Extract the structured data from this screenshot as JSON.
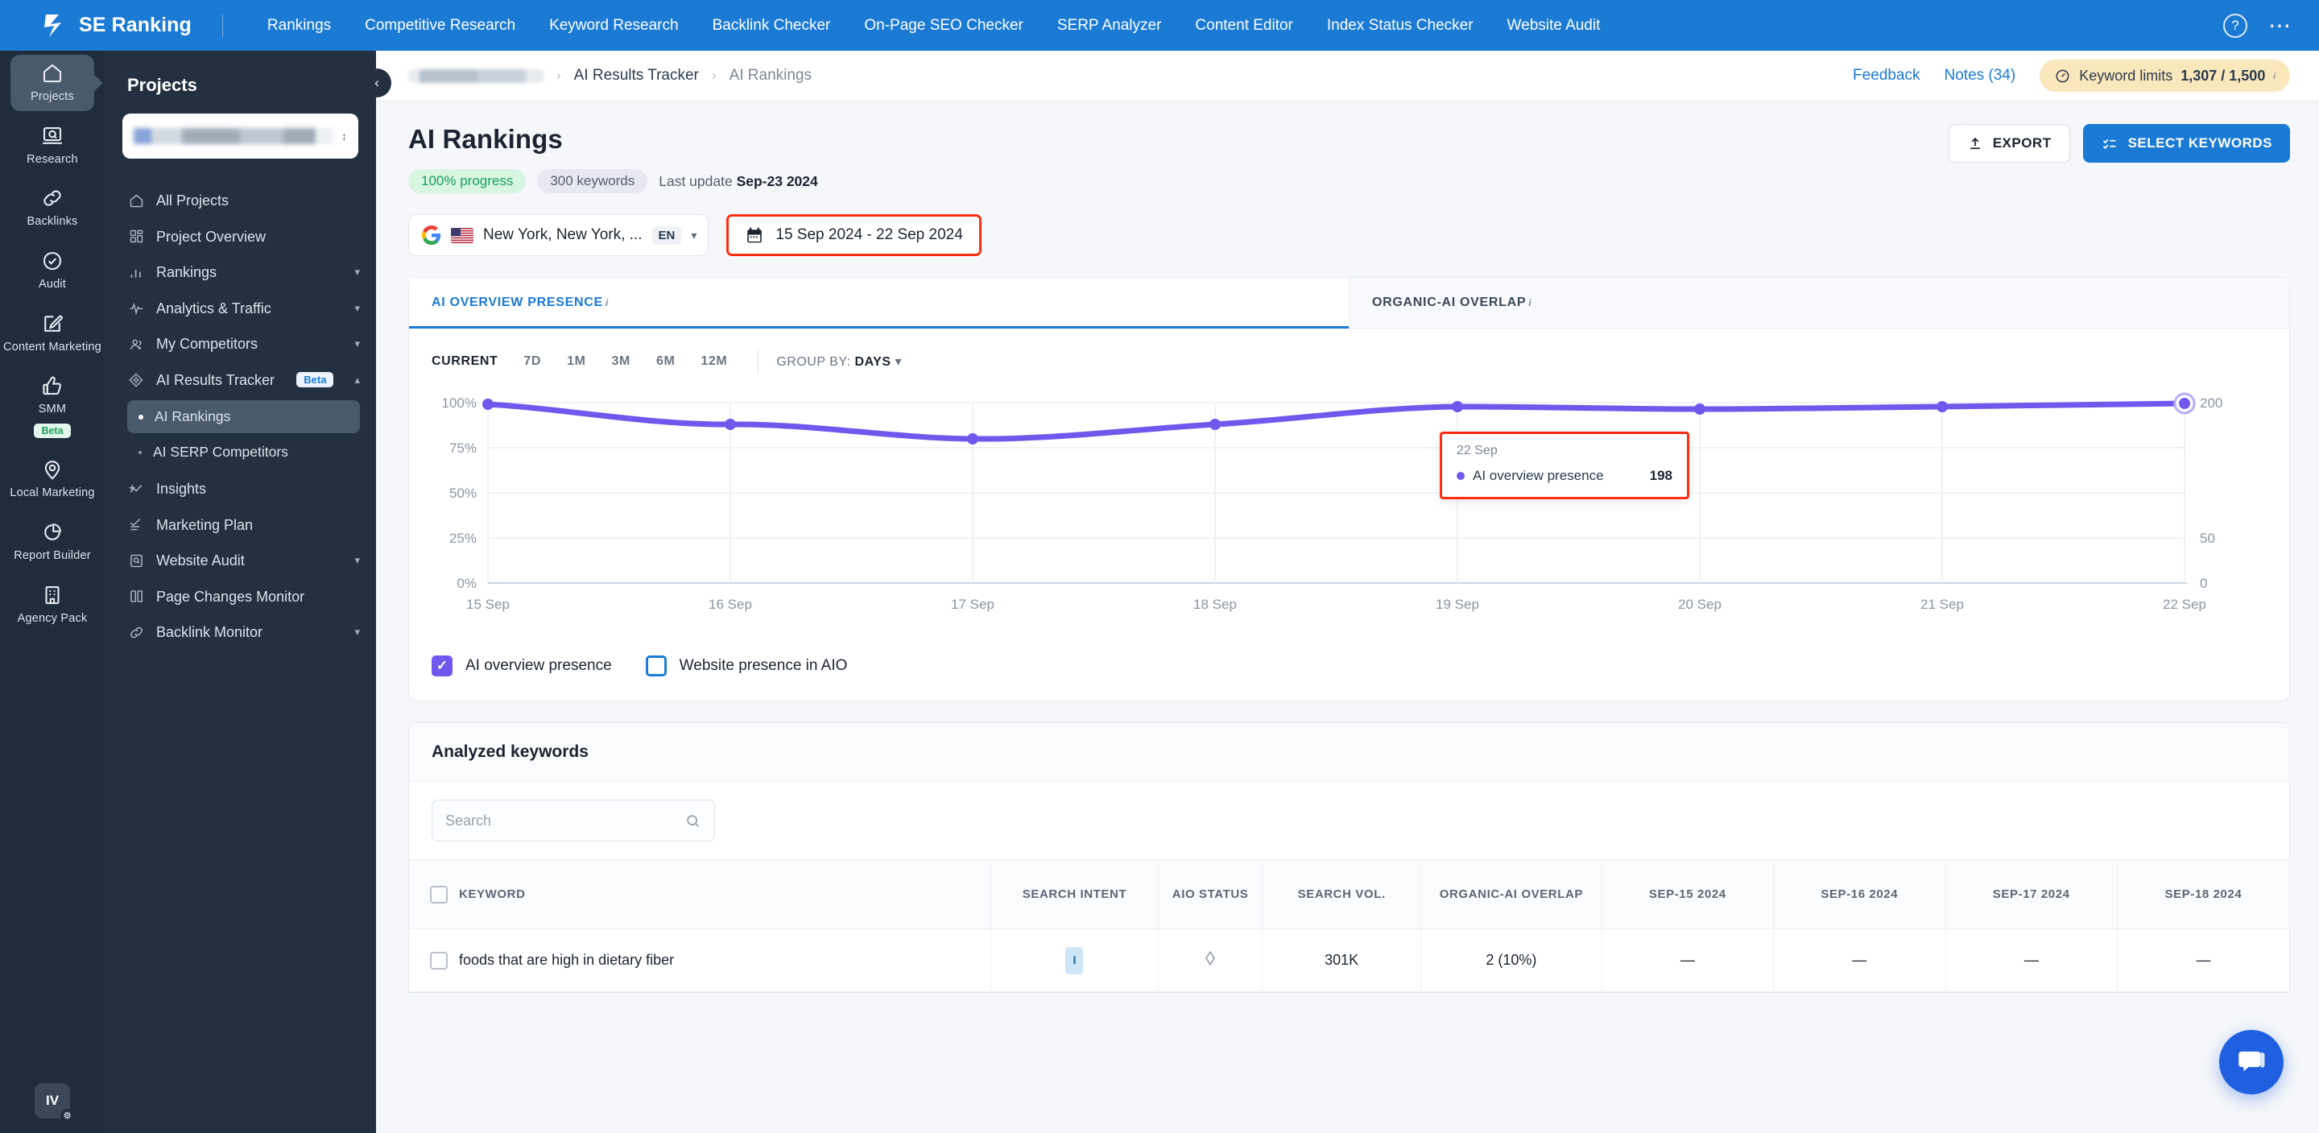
{
  "topbar": {
    "brand": "SE Ranking",
    "nav": [
      "Rankings",
      "Competitive Research",
      "Keyword Research",
      "Backlink Checker",
      "On-Page SEO Checker",
      "SERP Analyzer",
      "Content Editor",
      "Index Status Checker",
      "Website Audit"
    ],
    "help_label": "?",
    "more_label": "⋯"
  },
  "rail": {
    "items": [
      {
        "label": "Projects",
        "icon": "home-icon",
        "active": true,
        "beta": ""
      },
      {
        "label": "Research",
        "icon": "research-icon",
        "active": false,
        "beta": ""
      },
      {
        "label": "Backlinks",
        "icon": "link-icon",
        "active": false,
        "beta": ""
      },
      {
        "label": "Audit",
        "icon": "check-circle-icon",
        "active": false,
        "beta": ""
      },
      {
        "label": "Content Marketing",
        "icon": "edit-square-icon",
        "active": false,
        "beta": ""
      },
      {
        "label": "SMM",
        "icon": "thumbs-up-icon",
        "active": false,
        "beta": "Beta"
      },
      {
        "label": "Local Marketing",
        "icon": "map-pin-icon",
        "active": false,
        "beta": ""
      },
      {
        "label": "Report Builder",
        "icon": "pie-chart-icon",
        "active": false,
        "beta": ""
      },
      {
        "label": "Agency Pack",
        "icon": "building-icon",
        "active": false,
        "beta": ""
      }
    ],
    "avatar_initials": "IV"
  },
  "sidebar": {
    "title": "Projects",
    "project_selector_value": "",
    "items": [
      {
        "label": "All Projects",
        "icon": "home-icon",
        "chevron": false
      },
      {
        "label": "Project Overview",
        "icon": "grid-icon",
        "chevron": false
      },
      {
        "label": "Rankings",
        "icon": "bars-icon",
        "chevron": true
      },
      {
        "label": "Analytics & Traffic",
        "icon": "pulse-icon",
        "chevron": true
      },
      {
        "label": "My Competitors",
        "icon": "users-icon",
        "chevron": true
      },
      {
        "label": "AI Results Tracker",
        "icon": "ai-diamond-icon",
        "chevron": true,
        "badge": "Beta"
      },
      {
        "label": "Insights",
        "icon": "insights-icon",
        "chevron": false
      },
      {
        "label": "Marketing Plan",
        "icon": "checklist-icon",
        "chevron": false
      },
      {
        "label": "Website Audit",
        "icon": "audit-icon",
        "chevron": true
      },
      {
        "label": "Page Changes Monitor",
        "icon": "page-monitor-icon",
        "chevron": false
      },
      {
        "label": "Backlink Monitor",
        "icon": "link-icon",
        "chevron": true
      }
    ],
    "sub_items": [
      {
        "label": "AI Rankings",
        "active": true
      },
      {
        "label": "AI SERP Competitors",
        "active": false
      }
    ],
    "collapse_label": "‹"
  },
  "breadcrumb": {
    "project": "",
    "separator": "›",
    "section": "AI Results Tracker",
    "current": "AI Rankings",
    "feedback": "Feedback",
    "notes": "Notes (34)",
    "keyword_limits_label": "Keyword limits",
    "keyword_limits_value": "1,307 / 1,500"
  },
  "page": {
    "title": "AI Rankings",
    "progress_badge": "100% progress",
    "keywords_badge": "300 keywords",
    "last_update_label": "Last update",
    "last_update_value": "Sep-23 2024",
    "export_label": "EXPORT",
    "select_keywords_label": "SELECT KEYWORDS"
  },
  "filters": {
    "engine": "google-icon",
    "country": "us-flag-icon",
    "location": "New York, New York, ...",
    "language": "EN",
    "date_range": "15 Sep 2024 - 22 Sep 2024"
  },
  "chart_card": {
    "tabs": [
      {
        "label": "AI OVERVIEW PRESENCE",
        "active": true
      },
      {
        "label": "ORGANIC-AI OVERLAP",
        "active": false
      }
    ],
    "ranges": [
      {
        "label": "CURRENT",
        "active": true
      },
      {
        "label": "7D",
        "active": false
      },
      {
        "label": "1M",
        "active": false
      },
      {
        "label": "3M",
        "active": false
      },
      {
        "label": "6M",
        "active": false
      },
      {
        "label": "12M",
        "active": false
      }
    ],
    "group_by_label": "GROUP BY:",
    "group_by_value": "DAYS",
    "tooltip": {
      "date": "22 Sep",
      "series": "AI overview presence",
      "value": "198"
    },
    "legend": [
      {
        "label": "AI overview presence",
        "checked": true,
        "color": "#7257ed"
      },
      {
        "label": "Website presence in AIO",
        "checked": false,
        "color": "#1a7ad4"
      }
    ]
  },
  "chart_data": {
    "type": "line",
    "title": "AI overview presence",
    "x": [
      "15 Sep",
      "16 Sep",
      "17 Sep",
      "18 Sep",
      "19 Sep",
      "20 Sep",
      "21 Sep",
      "22 Sep"
    ],
    "series": [
      {
        "name": "AI overview presence",
        "color": "#7257ed",
        "values_pct": [
          99,
          88,
          80,
          88,
          97,
          96,
          97,
          98
        ],
        "values_abs": [
          198,
          176,
          160,
          176,
          194,
          193,
          194,
          198
        ]
      }
    ],
    "ylabel_left": "%",
    "ylabel_right": "count",
    "ytick_labels_left": [
      "100%",
      "75%",
      "50%",
      "25%",
      "0%"
    ],
    "ytick_values_left": [
      100,
      75,
      50,
      25,
      0
    ],
    "ytick_labels_right": [
      "200",
      "50",
      "0"
    ],
    "ytick_values_right": [
      200,
      50,
      0
    ],
    "ylim_left": [
      0,
      100
    ],
    "ylim_right": [
      0,
      200
    ],
    "xlabel": "",
    "grid": true,
    "legend_position": "bottom"
  },
  "table": {
    "section_title": "Analyzed keywords",
    "search_placeholder": "Search",
    "search_value": "",
    "columns": [
      "KEYWORD",
      "SEARCH INTENT",
      "AIO STATUS",
      "SEARCH VOL.",
      "ORGANIC-AI OVERLAP",
      "SEP-15 2024",
      "SEP-16 2024",
      "SEP-17 2024",
      "SEP-18 2024"
    ],
    "rows": [
      {
        "keyword": "foods that are high in dietary fiber",
        "search_intent": "I",
        "aio_status": "aio-diamond-icon",
        "search_volume": "301K",
        "organic_ai_overlap": "2 (10%)",
        "sep_15": "—",
        "sep_16": "—",
        "sep_17": "—",
        "sep_18": "—"
      }
    ]
  },
  "chat": {
    "icon": "chat-bubble-icon"
  }
}
